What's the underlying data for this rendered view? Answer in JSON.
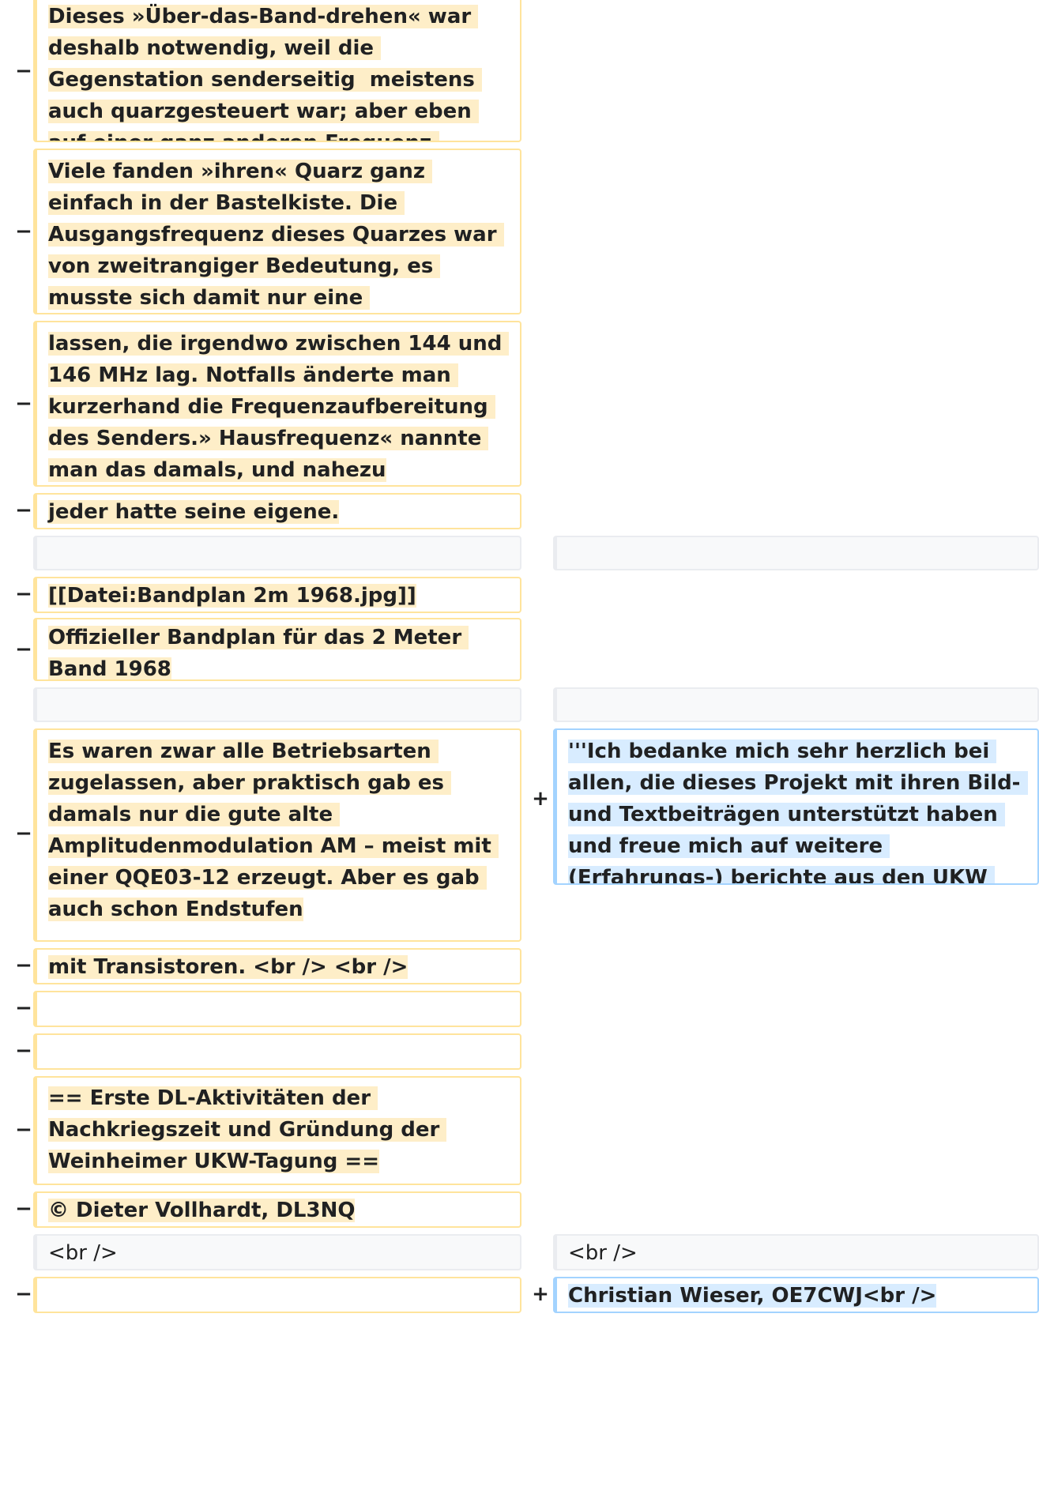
{
  "markers": {
    "removed": "−",
    "added": "+"
  },
  "rows": [
    {
      "left": "Dieses »Über-das-Band-drehen« war deshalb notwendig, weil die Gegenstation senderseitig  meistens auch quarzgesteuert war; aber eben auf einer ganz anderen Frequenz."
    },
    {
      "left": "Viele fanden »ihren« Quarz ganz einfach in der Bastelkiste. Die Ausgangsfrequenz dieses Quarzes war von zweitrangiger Bedeutung, es musste sich damit nur eine Endfrequenz erzeugen"
    },
    {
      "left": "lassen, die irgendwo zwischen 144 und 146 MHz lag. Notfalls änderte man kurzerhand die Frequenzaufbereitung des Senders.» Hausfrequenz« nannte man das damals, und nahezu"
    },
    {
      "left": "jeder hatte seine eigene."
    },
    {
      "left": "",
      "right": ""
    },
    {
      "left": "[[Datei:Bandplan 2m 1968.jpg]]"
    },
    {
      "left": "Offizieller Bandplan für das 2 Meter Band 1968"
    },
    {
      "left": "",
      "right": ""
    },
    {
      "left": "Es waren zwar alle Betriebsarten zugelassen, aber praktisch gab es damals nur die gute alte Amplitudenmodulation AM – meist mit einer QQE03-12 erzeugt. Aber es gab auch schon Endstufen",
      "right": "'''Ich bedanke mich sehr herzlich bei allen, die dieses Projekt mit ihren Bild- und Textbeiträgen unterstützt haben und freue mich auf weitere (Erfahrungs-) berichte aus den UKW Gründerzeiten.'''"
    },
    {
      "left": "mit Transistoren. <br /> <br />"
    },
    {
      "left": ""
    },
    {
      "left": ""
    },
    {
      "left": "== Erste DL-Aktivitäten der Nachkriegszeit und Gründung der Weinheimer UKW-Tagung =="
    },
    {
      "left": "© Dieter Vollhardt, DL3NQ"
    },
    {
      "left": "<br />",
      "right": "<br />"
    },
    {
      "left": "",
      "right": "Christian Wieser, OE7CWJ<br />"
    }
  ]
}
